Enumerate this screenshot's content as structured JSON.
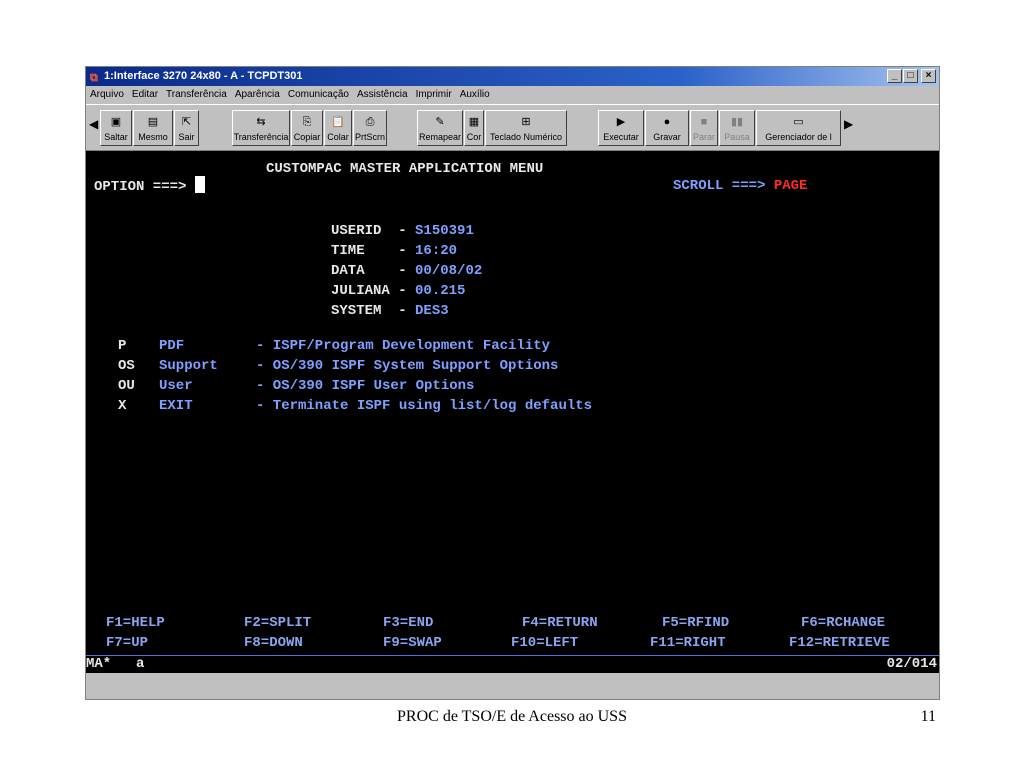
{
  "window": {
    "title": "1:Interface 3270 24x80 - A - TCPDT301",
    "minimize": "_",
    "maximize": "□",
    "close": "×"
  },
  "menu": [
    "Arquivo",
    "Editar",
    "Transferência",
    "Aparência",
    "Comunicação",
    "Assistência",
    "Imprimir",
    "Auxílio"
  ],
  "toolbar": {
    "saltar": "Saltar",
    "mesmo": "Mesmo",
    "sair": "Sair",
    "transferencia": "Transferência",
    "copiar": "Copiar",
    "colar": "Colar",
    "prtscrn": "PrtScrn",
    "remapear": "Remapear",
    "cor": "Cor",
    "teclado": "Teclado Numérico",
    "executar": "Executar",
    "gravar": "Gravar",
    "parar": "Parar",
    "pausa": "Pausa",
    "gerenciador": "Gerenciador de l"
  },
  "terminal": {
    "title": "CUSTOMPAC MASTER APPLICATION MENU",
    "option_label": "OPTION ===>",
    "scroll_label": "SCROLL ===>",
    "scroll_value": "PAGE",
    "info": [
      {
        "label": "USERID  -",
        "value": "S150391"
      },
      {
        "label": "TIME    -",
        "value": "16:20"
      },
      {
        "label": "DATA    -",
        "value": "00/08/02"
      },
      {
        "label": "JULIANA -",
        "value": "00.215"
      },
      {
        "label": "SYSTEM  -",
        "value": "DES3"
      }
    ],
    "options": [
      {
        "code": "P",
        "name": "PDF",
        "desc": "- ISPF/Program Development Facility"
      },
      {
        "code": "OS",
        "name": "Support",
        "desc": "- OS/390 ISPF System Support Options"
      },
      {
        "code": "OU",
        "name": "User",
        "desc": "- OS/390 ISPF User Options"
      },
      {
        "code": "X",
        "name": "EXIT",
        "desc": "- Terminate ISPF using list/log defaults"
      }
    ],
    "fkeys_row1": [
      "F1=HELP",
      "F2=SPLIT",
      "F3=END",
      "F4=RETURN",
      "F5=RFIND",
      "F6=RCHANGE"
    ],
    "fkeys_row2": [
      "F7=UP",
      "F8=DOWN",
      "F9=SWAP",
      "F10=LEFT",
      "F11=RIGHT",
      "F12=RETRIEVE"
    ],
    "status_left": "MA*",
    "status_mid": "a",
    "status_right": "02/014"
  },
  "caption": "PROC de TSO/E de Acesso ao USS",
  "page_number": "11"
}
